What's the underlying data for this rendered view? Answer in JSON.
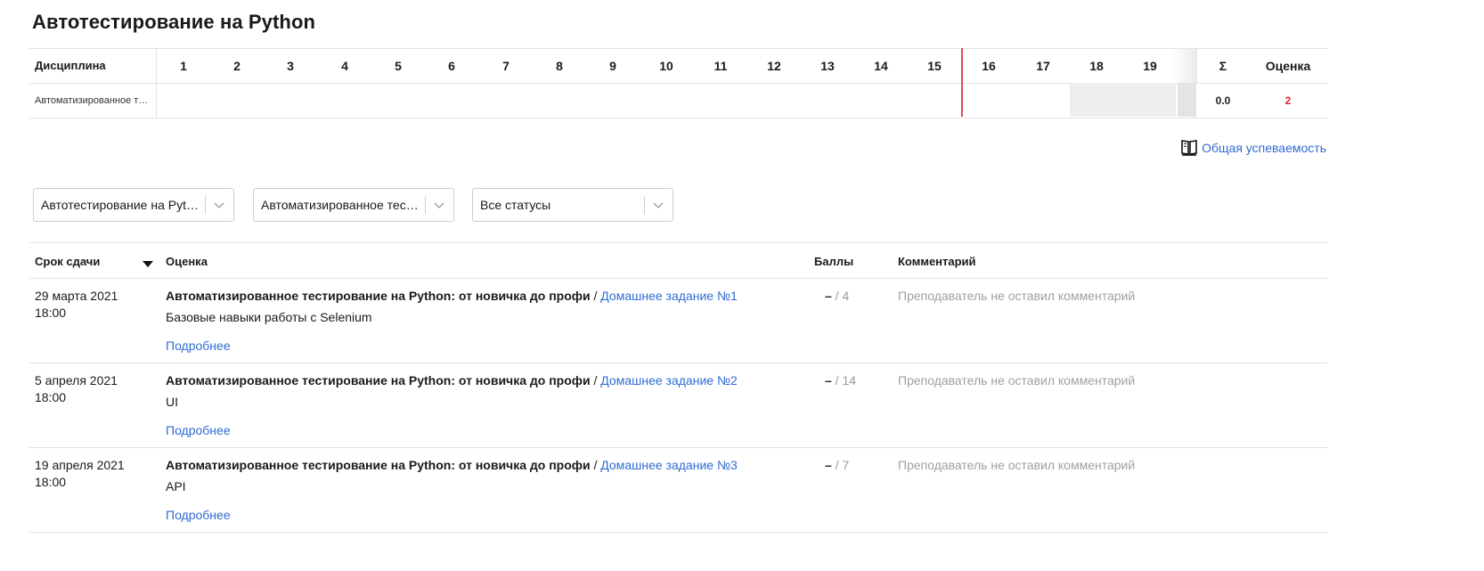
{
  "page_title": "Автотестирование на Python",
  "grades_table": {
    "discipline_header": "Дисциплина",
    "weeks": [
      "1",
      "2",
      "3",
      "4",
      "5",
      "6",
      "7",
      "8",
      "9",
      "10",
      "11",
      "12",
      "13",
      "14",
      "15",
      "16",
      "17",
      "18",
      "19"
    ],
    "sum_header": "Σ",
    "grade_header": "Оценка",
    "row": {
      "discipline": "Автоматизированное тестирование на Python: от новичка до профи",
      "sum": "0.0",
      "grade": "2"
    }
  },
  "overall_link": "Общая успеваемость",
  "filters": [
    {
      "value": "Автотестирование на Python"
    },
    {
      "value": "Автоматизированное тестирование на Python: от новичка до профи"
    },
    {
      "value": "Все статусы"
    }
  ],
  "tasks_table": {
    "headers": {
      "deadline": "Срок сдачи",
      "grade": "Оценка",
      "points": "Баллы",
      "comment": "Комментарий"
    },
    "rows": [
      {
        "date": "29 марта 2021\n18:00",
        "course": "Автоматизированное тестирование на Python: от новичка до профи",
        "separator": " / ",
        "homework": "Домашнее задание №1",
        "description": "Базовые навыки работы с Selenium",
        "more": "Подробнее",
        "score_dash": "–",
        "score_max": " / 4",
        "comment": "Преподаватель не оставил комментарий"
      },
      {
        "date": "5 апреля 2021\n18:00",
        "course": "Автоматизированное тестирование на Python: от новичка до профи",
        "separator": " / ",
        "homework": "Домашнее задание №2",
        "description": "UI",
        "more": "Подробнее",
        "score_dash": "–",
        "score_max": " / 14",
        "comment": "Преподаватель не оставил комментарий"
      },
      {
        "date": "19 апреля 2021\n18:00",
        "course": "Автоматизированное тестирование на Python: от новичка до профи",
        "separator": " / ",
        "homework": "Домашнее задание №3",
        "description": "API",
        "more": "Подробнее",
        "score_dash": "–",
        "score_max": " / 7",
        "comment": "Преподаватель не оставил комментарий"
      }
    ]
  },
  "colors": {
    "link": "#2f6bd3",
    "current_week_marker": "#e04a5a",
    "failing_grade": "#e3262c"
  }
}
